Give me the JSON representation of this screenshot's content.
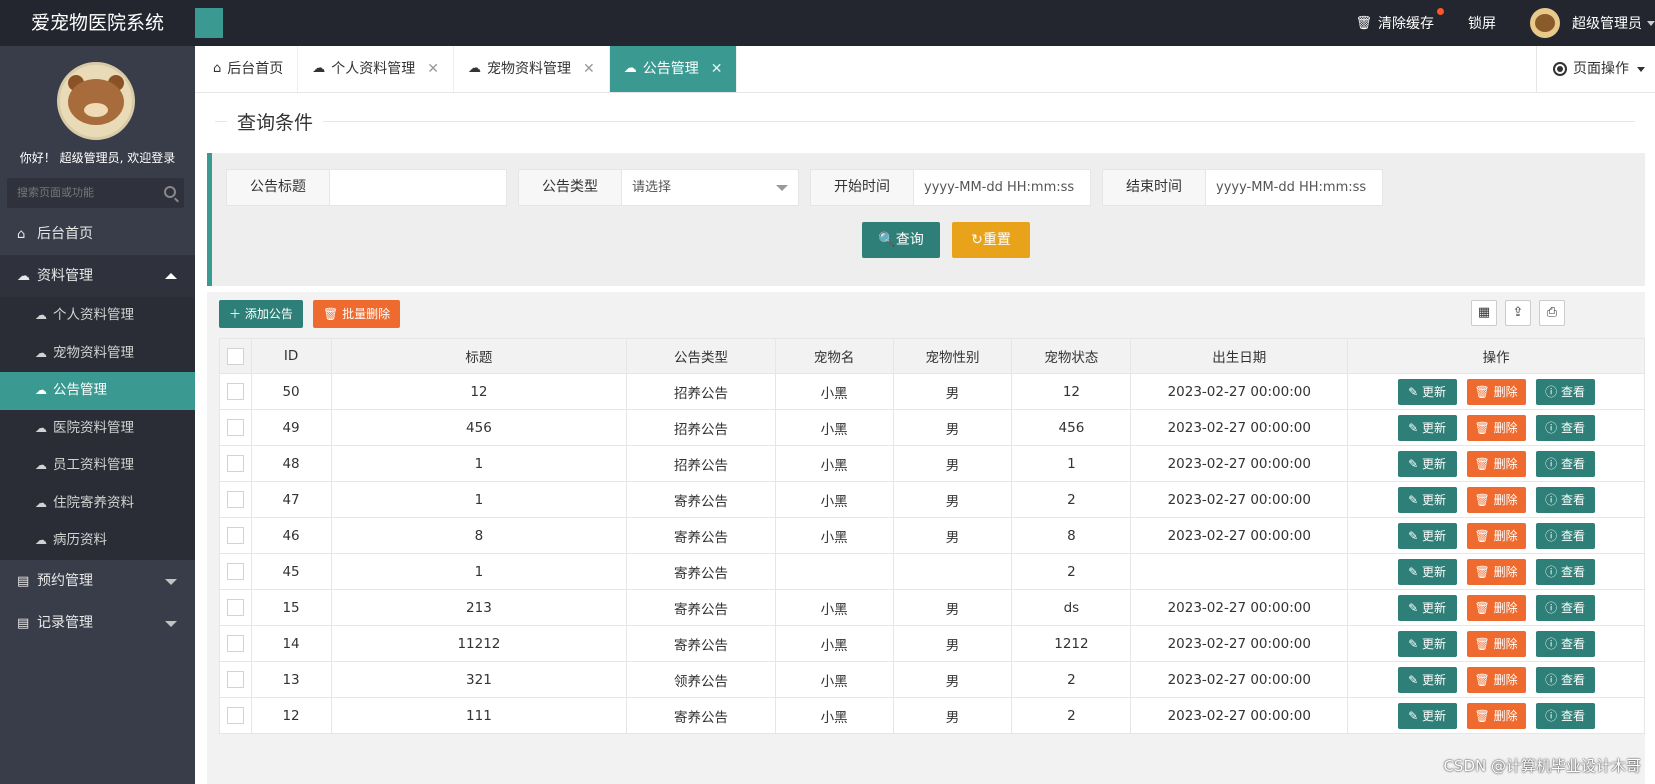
{
  "app": {
    "title": "爱宠物医院系统"
  },
  "header": {
    "clear_cache": "清除缓存",
    "lock_screen": "锁屏",
    "user": "超级管理员"
  },
  "sidebar": {
    "welcome": "你好！ 超级管理员, 欢迎登录",
    "search_placeholder": "搜索页面或功能",
    "home": "后台首页",
    "group_data": "资料管理",
    "sub_items": [
      {
        "label": "个人资料管理",
        "icon": "cloud-icon"
      },
      {
        "label": "宠物资料管理",
        "icon": "cloud-icon"
      },
      {
        "label": "公告管理",
        "icon": "cloud-icon"
      },
      {
        "label": "医院资料管理",
        "icon": "cloud-icon"
      },
      {
        "label": "员工资料管理",
        "icon": "cloud-icon"
      },
      {
        "label": "住院寄养资料",
        "icon": "cloud-icon"
      },
      {
        "label": "病历资料",
        "icon": "cloud-icon"
      }
    ],
    "group_appointment": "预约管理",
    "group_records": "记录管理"
  },
  "tabs": [
    {
      "label": "后台首页",
      "icon": "home-icon",
      "closable": false
    },
    {
      "label": "个人资料管理",
      "icon": "cloud-icon",
      "closable": true
    },
    {
      "label": "宠物资料管理",
      "icon": "cloud-icon",
      "closable": true
    },
    {
      "label": "公告管理",
      "icon": "cloud-icon",
      "closable": true,
      "active": true
    }
  ],
  "page_ops": "页面操作",
  "query": {
    "legend": "查询条件",
    "title_label": "公告标题",
    "title_value": "",
    "type_label": "公告类型",
    "type_placeholder": "请选择",
    "start_label": "开始时间",
    "start_placeholder": "yyyy-MM-dd HH:mm:ss",
    "end_label": "结束时间",
    "end_placeholder": "yyyy-MM-dd HH:mm:ss",
    "search_btn": "查询",
    "reset_btn": "重置"
  },
  "toolbar": {
    "add_btn": "添加公告",
    "batch_delete_btn": "批量删除"
  },
  "table": {
    "headers": [
      "ID",
      "标题",
      "公告类型",
      "宠物名",
      "宠物性别",
      "宠物状态",
      "出生日期",
      "操作"
    ],
    "row_buttons": {
      "update": "更新",
      "delete": "删除",
      "view": "查看"
    },
    "rows": [
      [
        "50",
        "12",
        "招养公告",
        "小黑",
        "男",
        "12",
        "2023-02-27 00:00:00"
      ],
      [
        "49",
        "456",
        "招养公告",
        "小黑",
        "男",
        "456",
        "2023-02-27 00:00:00"
      ],
      [
        "48",
        "1",
        "招养公告",
        "小黑",
        "男",
        "1",
        "2023-02-27 00:00:00"
      ],
      [
        "47",
        "1",
        "寄养公告",
        "小黑",
        "男",
        "2",
        "2023-02-27 00:00:00"
      ],
      [
        "46",
        "8",
        "寄养公告",
        "小黑",
        "男",
        "8",
        "2023-02-27 00:00:00"
      ],
      [
        "45",
        "1",
        "寄养公告",
        "",
        "",
        "2",
        ""
      ],
      [
        "15",
        "213",
        "寄养公告",
        "小黑",
        "男",
        "ds",
        "2023-02-27 00:00:00"
      ],
      [
        "14",
        "11212",
        "寄养公告",
        "小黑",
        "男",
        "1212",
        "2023-02-27 00:00:00"
      ],
      [
        "13",
        "321",
        "领养公告",
        "小黑",
        "男",
        "2",
        "2023-02-27 00:00:00"
      ],
      [
        "12",
        "111",
        "寄养公告",
        "小黑",
        "男",
        "2",
        "2023-02-27 00:00:00"
      ]
    ]
  },
  "watermark": "CSDN @计算机毕业设计木哥",
  "colors": {
    "accent": "#3a9a91",
    "header_bg": "#23262e",
    "sidebar_bg": "#393d49",
    "danger": "#ee6a2e",
    "warning": "#e8a31a"
  }
}
